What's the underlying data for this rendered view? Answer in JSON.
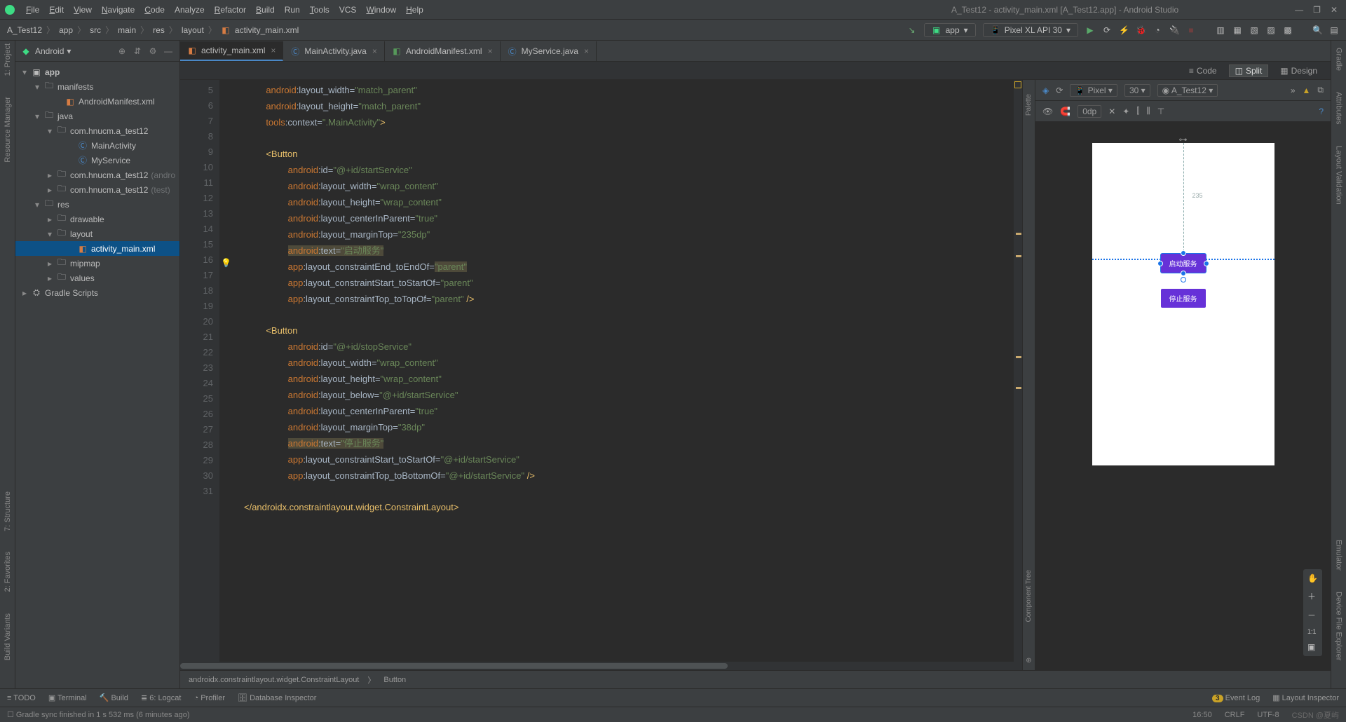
{
  "window": {
    "title": "A_Test12 - activity_main.xml [A_Test12.app] - Android Studio"
  },
  "menu": {
    "file": "File",
    "edit": "Edit",
    "view": "View",
    "navigate": "Navigate",
    "code": "Code",
    "analyze": "Analyze",
    "refactor": "Refactor",
    "build": "Build",
    "run": "Run",
    "tools": "Tools",
    "vcs": "VCS",
    "window": "Window",
    "help": "Help"
  },
  "breadcrumbs": [
    "A_Test12",
    "app",
    "src",
    "main",
    "res",
    "layout",
    "activity_main.xml"
  ],
  "runConfig": {
    "app": "app",
    "device": "Pixel XL API 30"
  },
  "projectPane": {
    "title": "Android"
  },
  "tree": {
    "app": "app",
    "manifests": "manifests",
    "androidManifest": "AndroidManifest.xml",
    "java": "java",
    "pkg1": "com.hnucm.a_test12",
    "mainActivity": "MainActivity",
    "myService": "MyService",
    "pkg2": "com.hnucm.a_test12",
    "pkg2suffix": "(andro",
    "pkg3": "com.hnucm.a_test12",
    "pkg3suffix": "(test)",
    "res": "res",
    "drawable": "drawable",
    "layout": "layout",
    "activityMain": "activity_main.xml",
    "mipmap": "mipmap",
    "values": "values",
    "gradle": "Gradle Scripts"
  },
  "tabs": {
    "t1": "activity_main.xml",
    "t2": "MainActivity.java",
    "t3": "AndroidManifest.xml",
    "t4": "MyService.java"
  },
  "viewModes": {
    "code": "Code",
    "split": "Split",
    "design": "Design"
  },
  "gutter": [
    "5",
    "6",
    "7",
    "8",
    "9",
    "10",
    "11",
    "12",
    "13",
    "14",
    "15",
    "16",
    "17",
    "18",
    "19",
    "20",
    "21",
    "22",
    "23",
    "24",
    "25",
    "26",
    "27",
    "28",
    "29",
    "30",
    "31"
  ],
  "code": {
    "l5a": "android",
    "l5b": ":layout_width=",
    "l5c": "\"match_parent\"",
    "l6a": "android",
    "l6b": ":layout_height=",
    "l6c": "\"match_parent\"",
    "l7a": "tools",
    "l7b": ":context=",
    "l7c": "\".MainActivity\"",
    "l7d": ">",
    "l9": "<Button",
    "l10a": "android",
    "l10b": ":id=",
    "l10c": "\"@+id/startService\"",
    "l11a": "android",
    "l11b": ":layout_width=",
    "l11c": "\"wrap_content\"",
    "l12a": "android",
    "l12b": ":layout_height=",
    "l12c": "\"wrap_content\"",
    "l13a": "android",
    "l13b": ":layout_centerInParent=",
    "l13c": "\"true\"",
    "l14a": "android",
    "l14b": ":layout_marginTop=",
    "l14c": "\"235dp\"",
    "l15a": "android",
    "l15b": ":text=",
    "l15c": "\"启动服务\"",
    "l16a": "app",
    "l16b": ":layout_constraintEnd_toEndOf=",
    "l16c": "\"parent\"",
    "l17a": "app",
    "l17b": ":layout_constraintStart_toStartOf=",
    "l17c": "\"parent\"",
    "l18a": "app",
    "l18b": ":layout_constraintTop_toTopOf=",
    "l18c": "\"parent\"",
    "l18d": " />",
    "l20": "<Button",
    "l21a": "android",
    "l21b": ":id=",
    "l21c": "\"@+id/stopService\"",
    "l22a": "android",
    "l22b": ":layout_width=",
    "l22c": "\"wrap_content\"",
    "l23a": "android",
    "l23b": ":layout_height=",
    "l23c": "\"wrap_content\"",
    "l24a": "android",
    "l24b": ":layout_below=",
    "l24c": "\"@+id/startService\"",
    "l25a": "android",
    "l25b": ":layout_centerInParent=",
    "l25c": "\"true\"",
    "l26a": "android",
    "l26b": ":layout_marginTop=",
    "l26c": "\"38dp\"",
    "l27a": "android",
    "l27b": ":text=",
    "l27c": "\"停止服务\"",
    "l28a": "app",
    "l28b": ":layout_constraintStart_toStartOf=",
    "l28c": "\"@+id/startService\"",
    "l29a": "app",
    "l29b": ":layout_constraintTop_toBottomOf=",
    "l29c": "\"@+id/startService\"",
    "l29d": " />",
    "l31": "</androidx.constraintlayout.widget.ConstraintLayout>"
  },
  "editorCrumb": {
    "a": "androidx.constraintlayout.widget.ConstraintLayout",
    "b": "Button"
  },
  "preview": {
    "device": "Pixel",
    "api": "30",
    "app": "A_Test12",
    "odp": "0dp",
    "startBtn": "启动服务",
    "stopBtn": "停止服务",
    "marginLabel": "235"
  },
  "sidepanels": {
    "palette": "Palette",
    "componentTree": "Component Tree",
    "gradle": "Gradle",
    "attributes": "Attributes",
    "layoutValidation": "Layout Validation",
    "emulator": "Emulator",
    "deviceFile": "Device File Explorer"
  },
  "leftSide": {
    "project": "1: Project",
    "resMgr": "Resource Manager",
    "structure": "7: Structure",
    "favorites": "2: Favorites",
    "buildVariants": "Build Variants"
  },
  "bottom": {
    "todo": "TODO",
    "terminal": "Terminal",
    "build": "Build",
    "logcat": "6: Logcat",
    "profiler": "Profiler",
    "db": "Database Inspector",
    "eventlog": "Event Log",
    "eventlogBadge": "3",
    "layoutInsp": "Layout Inspector"
  },
  "status": {
    "msg": "Gradle sync finished in 1 s 532 ms (6 minutes ago)",
    "pos": "16:50",
    "crlf": "CRLF",
    "enc": "UTF-8",
    "watermark": "CSDN @夏屿"
  }
}
